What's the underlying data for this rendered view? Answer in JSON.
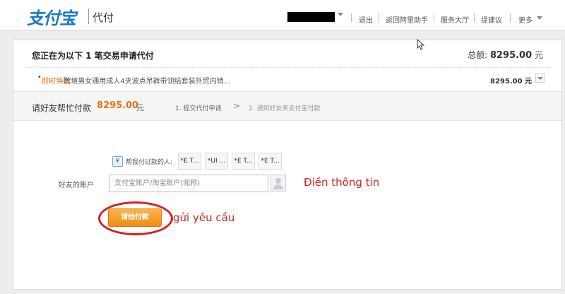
{
  "header": {
    "logo": "支付宝",
    "product": "代付",
    "nav": [
      "退出",
      "返回阿里助手",
      "服务大厅",
      "提建议",
      "更多"
    ]
  },
  "order": {
    "title": "您正在为以下 1 笔交易申请代付",
    "total_label": "总额:",
    "total_amount": "8295.00",
    "total_unit": "元",
    "item_tag": "即时到账",
    "item_title": "--跨境男女通用成人4夹波点吊裤带领结套装外贸内销...",
    "item_price": "8295.00 元"
  },
  "pay_strip": {
    "label": "请好友帮忙付款",
    "amount": "8295.00",
    "unit": "元",
    "step1": "1. 提交代付申请",
    "arrow": ">",
    "step2": "2. 通知好友来支付宝付款"
  },
  "form": {
    "payer_icon": "¥",
    "payer_label": "帮我付过款的人:",
    "payer_chips": [
      "*E T...",
      "*UI ...",
      "*E T...",
      "*E T..."
    ],
    "account_label": "好友的账户",
    "account_placeholder": "支付宝账户/淘宝账户(昵称)",
    "submit_label": "请他付款"
  },
  "annotations": {
    "fill_info": "Điền thông tin",
    "send_request": "gửi yêu cầu"
  },
  "colors": {
    "brand_blue": "#1a78c2",
    "orange": "#f08d15",
    "annotation_red": "#d32020"
  }
}
